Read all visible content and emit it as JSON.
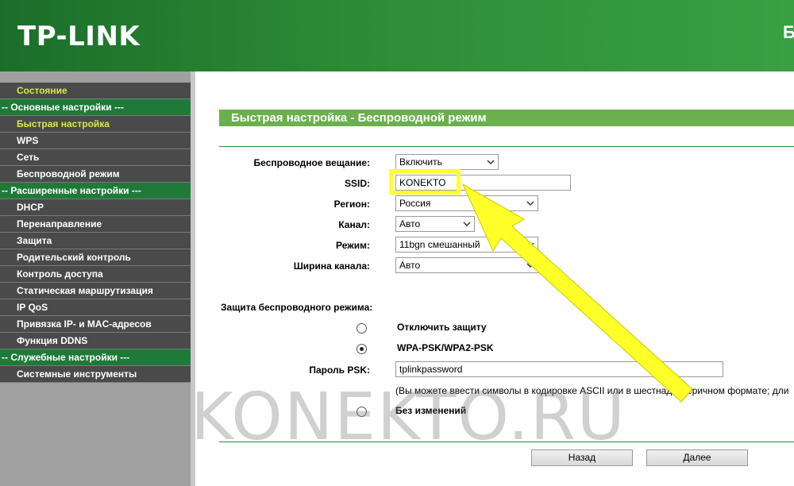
{
  "header": {
    "brand": "TP-LINK",
    "right_text": "Бе"
  },
  "sidebar": {
    "items": [
      {
        "label": "Состояние",
        "type": "item",
        "active": true
      },
      {
        "label": "-- Основные настройки ---",
        "type": "group"
      },
      {
        "label": "Быстрая настройка",
        "type": "item",
        "active": true
      },
      {
        "label": "WPS",
        "type": "item"
      },
      {
        "label": "Сеть",
        "type": "item"
      },
      {
        "label": "Беспроводной режим",
        "type": "item"
      },
      {
        "label": "-- Расширенные настройки ---",
        "type": "group"
      },
      {
        "label": "DHCP",
        "type": "item"
      },
      {
        "label": "Перенаправление",
        "type": "item"
      },
      {
        "label": "Защита",
        "type": "item"
      },
      {
        "label": "Родительский контроль",
        "type": "item"
      },
      {
        "label": "Контроль доступа",
        "type": "item"
      },
      {
        "label": "Статическая маршрутизация",
        "type": "item"
      },
      {
        "label": "IP QoS",
        "type": "item"
      },
      {
        "label": "Привязка IP- и MAC-адресов",
        "type": "item"
      },
      {
        "label": "Функция DDNS",
        "type": "item"
      },
      {
        "label": "-- Служебные настройки ---",
        "type": "group"
      },
      {
        "label": "Системные инструменты",
        "type": "item"
      }
    ]
  },
  "main": {
    "title": "Быстрая настройка - Беспроводной режим",
    "fields": {
      "broadcast": {
        "label": "Беспроводное вещание:",
        "value": "Включить"
      },
      "ssid": {
        "label": "SSID:",
        "value": "KONEKTO"
      },
      "region": {
        "label": "Регион:",
        "value": "Россия"
      },
      "channel": {
        "label": "Канал:",
        "value": "Авто"
      },
      "mode": {
        "label": "Режим:",
        "value": "11bgn смешанный"
      },
      "width": {
        "label": "Ширина канала:",
        "value": "Авто"
      }
    },
    "security": {
      "heading": "Защита беспроводного режима:",
      "options": [
        {
          "label": "Отключить защиту",
          "checked": false
        },
        {
          "label": "WPA-PSK/WPA2-PSK",
          "checked": true
        },
        {
          "label": "Без изменений",
          "checked": false
        }
      ],
      "psk_label": "Пароль PSK:",
      "psk_value": "tplinkpassword",
      "note": "(Вы можете ввести символы в кодировке ASCII или в шестнадцатеричном формате; дли"
    },
    "buttons": {
      "back": "Назад",
      "next": "Далее"
    }
  },
  "watermark": "KONEKTO.RU",
  "colors": {
    "header_green": "#2c8c36",
    "group_green": "#1f7a3a",
    "title_green": "#6ab04c",
    "menu_dark": "#4a4a4a",
    "active_text": "#d8e84a",
    "highlight_yellow": "#ffff2a"
  },
  "icons": {
    "dropdown": "chevron-down-icon",
    "annotation": "arrow-icon"
  }
}
